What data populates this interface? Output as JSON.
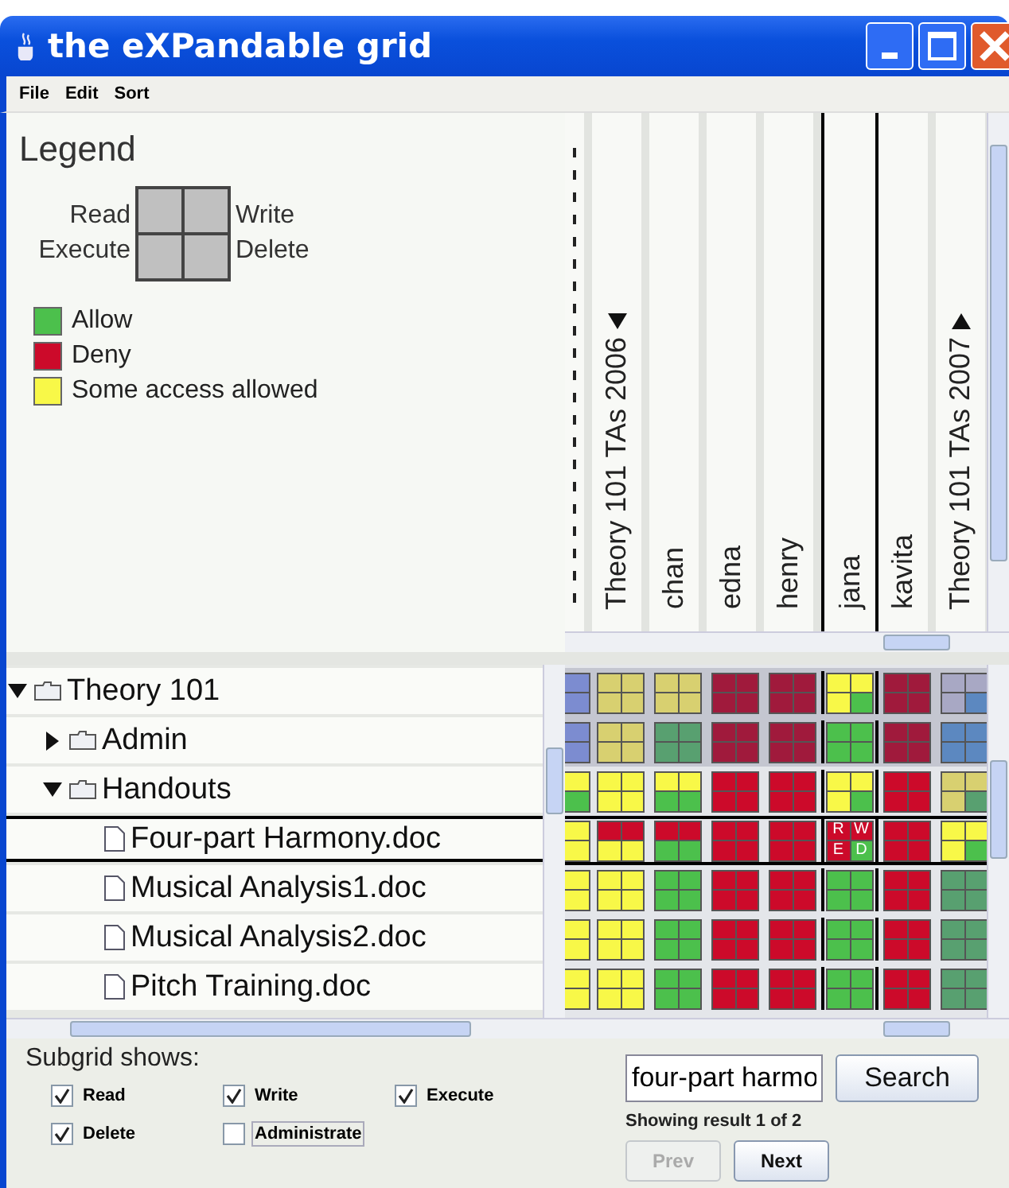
{
  "window": {
    "title": "the eXPandable grid"
  },
  "menu": [
    {
      "label": "File"
    },
    {
      "label": "Edit"
    },
    {
      "label": "Sort"
    }
  ],
  "legend": {
    "title": "Legend",
    "quadrants": [
      "Read",
      "Write",
      "Execute",
      "Delete"
    ],
    "items": [
      {
        "label": "Allow",
        "color": "#4cc04c"
      },
      {
        "label": "Deny",
        "color": "#cc0a2a"
      },
      {
        "label": "Some access allowed",
        "color": "#f8f848"
      }
    ]
  },
  "columns": [
    {
      "kind": "cut",
      "selected": false
    },
    {
      "kind": "group",
      "label": "Theory 101 TAs 2006",
      "expanded": true,
      "selected": false
    },
    {
      "kind": "user",
      "label": "chan",
      "selected": false
    },
    {
      "kind": "user",
      "label": "edna",
      "selected": false
    },
    {
      "kind": "user",
      "label": "henry",
      "selected": false
    },
    {
      "kind": "user",
      "label": "jana",
      "selected": true
    },
    {
      "kind": "user",
      "label": "kavita",
      "selected": false
    },
    {
      "kind": "group",
      "label": "Theory 101 TAs 2007",
      "expanded": false,
      "selected": false
    }
  ],
  "tree": [
    {
      "kind": "folder",
      "name": "Theory 101",
      "expanded": true,
      "selected": false,
      "shaded": true,
      "cells": [
        [
          {
            "color": "#7c8cd0"
          },
          {
            "color": "#7c8cd0"
          }
        ],
        [
          {
            "color": "#d8d070"
          },
          {
            "color": "#d8d070"
          },
          {
            "color": "#d8d070"
          },
          {
            "color": "#d8d070"
          }
        ],
        [
          {
            "color": "#d8d070"
          },
          {
            "color": "#d8d070"
          },
          {
            "color": "#d8d070"
          },
          {
            "color": "#d8d070"
          }
        ],
        [
          {
            "color": "#a01a3c"
          },
          {
            "color": "#a01a3c"
          },
          {
            "color": "#a01a3c"
          },
          {
            "color": "#a01a3c"
          }
        ],
        [
          {
            "color": "#a01a3c"
          },
          {
            "color": "#a01a3c"
          },
          {
            "color": "#a01a3c"
          },
          {
            "color": "#a01a3c"
          }
        ],
        [
          {
            "color": "#f8f848"
          },
          {
            "color": "#f8f848"
          },
          {
            "color": "#f8f848"
          },
          {
            "color": "#4cc04c"
          }
        ],
        [
          {
            "color": "#a01a3c"
          },
          {
            "color": "#a01a3c"
          },
          {
            "color": "#a01a3c"
          },
          {
            "color": "#a01a3c"
          }
        ],
        [
          {
            "color": "#a8a8c4"
          },
          {
            "color": "#a8a8c4"
          },
          {
            "color": "#a8a8c4"
          },
          {
            "color": "#5c88c0"
          }
        ]
      ],
      "children": [
        {
          "kind": "folder",
          "name": "Admin",
          "expanded": false,
          "selected": false,
          "shaded": true,
          "cells": [
            [
              {
                "color": "#7c8cd0"
              },
              {
                "color": "#7c8cd0"
              }
            ],
            [
              {
                "color": "#d8d070"
              },
              {
                "color": "#d8d070"
              },
              {
                "color": "#d8d070"
              },
              {
                "color": "#d8d070"
              }
            ],
            [
              {
                "color": "#58a070"
              },
              {
                "color": "#58a070"
              },
              {
                "color": "#58a070"
              },
              {
                "color": "#58a070"
              }
            ],
            [
              {
                "color": "#a01a3c"
              },
              {
                "color": "#a01a3c"
              },
              {
                "color": "#a01a3c"
              },
              {
                "color": "#a01a3c"
              }
            ],
            [
              {
                "color": "#a01a3c"
              },
              {
                "color": "#a01a3c"
              },
              {
                "color": "#a01a3c"
              },
              {
                "color": "#a01a3c"
              }
            ],
            [
              {
                "color": "#4cc04c"
              },
              {
                "color": "#4cc04c"
              },
              {
                "color": "#4cc04c"
              },
              {
                "color": "#4cc04c"
              }
            ],
            [
              {
                "color": "#a01a3c"
              },
              {
                "color": "#a01a3c"
              },
              {
                "color": "#a01a3c"
              },
              {
                "color": "#a01a3c"
              }
            ],
            [
              {
                "color": "#5c88c0"
              },
              {
                "color": "#5c88c0"
              },
              {
                "color": "#5c88c0"
              },
              {
                "color": "#5c88c0"
              }
            ]
          ]
        },
        {
          "kind": "folder",
          "name": "Handouts",
          "expanded": true,
          "selected": false,
          "shaded": false,
          "cells": [
            [
              {
                "color": "#f8f848"
              },
              {
                "color": "#4cc04c"
              }
            ],
            [
              {
                "color": "#f8f848"
              },
              {
                "color": "#f8f848"
              },
              {
                "color": "#f8f848"
              },
              {
                "color": "#f8f848"
              }
            ],
            [
              {
                "color": "#f8f848"
              },
              {
                "color": "#f8f848"
              },
              {
                "color": "#4cc04c"
              },
              {
                "color": "#4cc04c"
              }
            ],
            [
              {
                "color": "#cc0a2a"
              },
              {
                "color": "#cc0a2a"
              },
              {
                "color": "#cc0a2a"
              },
              {
                "color": "#cc0a2a"
              }
            ],
            [
              {
                "color": "#cc0a2a"
              },
              {
                "color": "#cc0a2a"
              },
              {
                "color": "#cc0a2a"
              },
              {
                "color": "#cc0a2a"
              }
            ],
            [
              {
                "color": "#f8f848"
              },
              {
                "color": "#f8f848"
              },
              {
                "color": "#f8f848"
              },
              {
                "color": "#4cc04c"
              }
            ],
            [
              {
                "color": "#cc0a2a"
              },
              {
                "color": "#cc0a2a"
              },
              {
                "color": "#cc0a2a"
              },
              {
                "color": "#cc0a2a"
              }
            ],
            [
              {
                "color": "#d8d070"
              },
              {
                "color": "#d8d070"
              },
              {
                "color": "#d8d070"
              },
              {
                "color": "#58a070"
              }
            ]
          ],
          "children": [
            {
              "kind": "file",
              "name": "Four-part Harmony.doc",
              "selected": true,
              "shaded": false,
              "cells": [
                [
                  {
                    "color": "#f8f848"
                  },
                  {
                    "color": "#f8f848"
                  }
                ],
                [
                  {
                    "color": "#cc0a2a"
                  },
                  {
                    "color": "#cc0a2a"
                  },
                  {
                    "color": "#f8f848"
                  },
                  {
                    "color": "#f8f848"
                  }
                ],
                [
                  {
                    "color": "#cc0a2a"
                  },
                  {
                    "color": "#cc0a2a"
                  },
                  {
                    "color": "#4cc04c"
                  },
                  {
                    "color": "#4cc04c"
                  }
                ],
                [
                  {
                    "color": "#cc0a2a"
                  },
                  {
                    "color": "#cc0a2a"
                  },
                  {
                    "color": "#cc0a2a"
                  },
                  {
                    "color": "#cc0a2a"
                  }
                ],
                [
                  {
                    "color": "#cc0a2a"
                  },
                  {
                    "color": "#cc0a2a"
                  },
                  {
                    "color": "#cc0a2a"
                  },
                  {
                    "color": "#cc0a2a"
                  }
                ],
                [
                  {
                    "color": "#cc0a2a",
                    "label": "R"
                  },
                  {
                    "color": "#cc0a2a",
                    "label": "W"
                  },
                  {
                    "color": "#cc0a2a",
                    "label": "E"
                  },
                  {
                    "color": "#4cc04c",
                    "label": "D"
                  }
                ],
                [
                  {
                    "color": "#cc0a2a"
                  },
                  {
                    "color": "#cc0a2a"
                  },
                  {
                    "color": "#cc0a2a"
                  },
                  {
                    "color": "#cc0a2a"
                  }
                ],
                [
                  {
                    "color": "#f8f848"
                  },
                  {
                    "color": "#f8f848"
                  },
                  {
                    "color": "#f8f848"
                  },
                  {
                    "color": "#4cc04c"
                  }
                ]
              ]
            },
            {
              "kind": "file",
              "name": "Musical Analysis1.doc",
              "selected": false,
              "shaded": false,
              "cells": [
                [
                  {
                    "color": "#f8f848"
                  },
                  {
                    "color": "#f8f848"
                  }
                ],
                [
                  {
                    "color": "#f8f848"
                  },
                  {
                    "color": "#f8f848"
                  },
                  {
                    "color": "#f8f848"
                  },
                  {
                    "color": "#f8f848"
                  }
                ],
                [
                  {
                    "color": "#4cc04c"
                  },
                  {
                    "color": "#4cc04c"
                  },
                  {
                    "color": "#4cc04c"
                  },
                  {
                    "color": "#4cc04c"
                  }
                ],
                [
                  {
                    "color": "#cc0a2a"
                  },
                  {
                    "color": "#cc0a2a"
                  },
                  {
                    "color": "#cc0a2a"
                  },
                  {
                    "color": "#cc0a2a"
                  }
                ],
                [
                  {
                    "color": "#cc0a2a"
                  },
                  {
                    "color": "#cc0a2a"
                  },
                  {
                    "color": "#cc0a2a"
                  },
                  {
                    "color": "#cc0a2a"
                  }
                ],
                [
                  {
                    "color": "#4cc04c"
                  },
                  {
                    "color": "#4cc04c"
                  },
                  {
                    "color": "#4cc04c"
                  },
                  {
                    "color": "#4cc04c"
                  }
                ],
                [
                  {
                    "color": "#cc0a2a"
                  },
                  {
                    "color": "#cc0a2a"
                  },
                  {
                    "color": "#cc0a2a"
                  },
                  {
                    "color": "#cc0a2a"
                  }
                ],
                [
                  {
                    "color": "#58a070"
                  },
                  {
                    "color": "#58a070"
                  },
                  {
                    "color": "#58a070"
                  },
                  {
                    "color": "#58a070"
                  }
                ]
              ]
            },
            {
              "kind": "file",
              "name": "Musical Analysis2.doc",
              "selected": false,
              "shaded": false,
              "cells": [
                [
                  {
                    "color": "#f8f848"
                  },
                  {
                    "color": "#f8f848"
                  }
                ],
                [
                  {
                    "color": "#f8f848"
                  },
                  {
                    "color": "#f8f848"
                  },
                  {
                    "color": "#f8f848"
                  },
                  {
                    "color": "#f8f848"
                  }
                ],
                [
                  {
                    "color": "#4cc04c"
                  },
                  {
                    "color": "#4cc04c"
                  },
                  {
                    "color": "#4cc04c"
                  },
                  {
                    "color": "#4cc04c"
                  }
                ],
                [
                  {
                    "color": "#cc0a2a"
                  },
                  {
                    "color": "#cc0a2a"
                  },
                  {
                    "color": "#cc0a2a"
                  },
                  {
                    "color": "#cc0a2a"
                  }
                ],
                [
                  {
                    "color": "#cc0a2a"
                  },
                  {
                    "color": "#cc0a2a"
                  },
                  {
                    "color": "#cc0a2a"
                  },
                  {
                    "color": "#cc0a2a"
                  }
                ],
                [
                  {
                    "color": "#4cc04c"
                  },
                  {
                    "color": "#4cc04c"
                  },
                  {
                    "color": "#4cc04c"
                  },
                  {
                    "color": "#4cc04c"
                  }
                ],
                [
                  {
                    "color": "#cc0a2a"
                  },
                  {
                    "color": "#cc0a2a"
                  },
                  {
                    "color": "#cc0a2a"
                  },
                  {
                    "color": "#cc0a2a"
                  }
                ],
                [
                  {
                    "color": "#58a070"
                  },
                  {
                    "color": "#58a070"
                  },
                  {
                    "color": "#58a070"
                  },
                  {
                    "color": "#58a070"
                  }
                ]
              ]
            },
            {
              "kind": "file",
              "name": "Pitch Training.doc",
              "selected": false,
              "shaded": false,
              "cells": [
                [
                  {
                    "color": "#f8f848"
                  },
                  {
                    "color": "#f8f848"
                  }
                ],
                [
                  {
                    "color": "#f8f848"
                  },
                  {
                    "color": "#f8f848"
                  },
                  {
                    "color": "#f8f848"
                  },
                  {
                    "color": "#f8f848"
                  }
                ],
                [
                  {
                    "color": "#4cc04c"
                  },
                  {
                    "color": "#4cc04c"
                  },
                  {
                    "color": "#4cc04c"
                  },
                  {
                    "color": "#4cc04c"
                  }
                ],
                [
                  {
                    "color": "#cc0a2a"
                  },
                  {
                    "color": "#cc0a2a"
                  },
                  {
                    "color": "#cc0a2a"
                  },
                  {
                    "color": "#cc0a2a"
                  }
                ],
                [
                  {
                    "color": "#cc0a2a"
                  },
                  {
                    "color": "#cc0a2a"
                  },
                  {
                    "color": "#cc0a2a"
                  },
                  {
                    "color": "#cc0a2a"
                  }
                ],
                [
                  {
                    "color": "#4cc04c"
                  },
                  {
                    "color": "#4cc04c"
                  },
                  {
                    "color": "#4cc04c"
                  },
                  {
                    "color": "#4cc04c"
                  }
                ],
                [
                  {
                    "color": "#cc0a2a"
                  },
                  {
                    "color": "#cc0a2a"
                  },
                  {
                    "color": "#cc0a2a"
                  },
                  {
                    "color": "#cc0a2a"
                  }
                ],
                [
                  {
                    "color": "#58a070"
                  },
                  {
                    "color": "#58a070"
                  },
                  {
                    "color": "#58a070"
                  },
                  {
                    "color": "#58a070"
                  }
                ]
              ]
            }
          ]
        }
      ]
    }
  ],
  "subgrid": {
    "title": "Subgrid shows:",
    "options": [
      {
        "label": "Read",
        "checked": true,
        "focused": false
      },
      {
        "label": "Write",
        "checked": true,
        "focused": false
      },
      {
        "label": "Execute",
        "checked": true,
        "focused": false
      },
      {
        "label": "Delete",
        "checked": true,
        "focused": false
      },
      {
        "label": "Administrate",
        "checked": false,
        "focused": true
      }
    ]
  },
  "search": {
    "value": "four-part harmo",
    "button": "Search",
    "status": "Showing result 1 of 2",
    "prev": {
      "label": "Prev",
      "disabled": true
    },
    "next": {
      "label": "Next",
      "disabled": false
    }
  }
}
